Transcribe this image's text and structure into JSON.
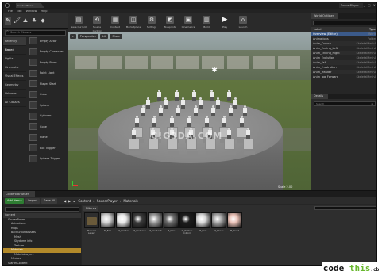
{
  "titlebar": {
    "doc_tab": "ContentExam...",
    "project": "SoccerPlayer",
    "controls": [
      "_",
      "□",
      "✕"
    ]
  },
  "menu": [
    "File",
    "Edit",
    "Window",
    "Help"
  ],
  "modes": {
    "search_placeholder": "Search Classes",
    "categories": [
      "Recently Placed",
      "Basic",
      "Lights",
      "Cinematic",
      "Visual Effects",
      "Geometry",
      "Volumes",
      "All Classes"
    ],
    "items": [
      "Empty Actor",
      "Empty Character",
      "Empty Pawn",
      "Point Light",
      "Player Start",
      "Cube",
      "Sphere",
      "Cylinder",
      "Cone",
      "Plane",
      "Box Trigger",
      "Sphere Trigger"
    ]
  },
  "toolbar": [
    {
      "label": "Save Current",
      "icon": "save-icon",
      "glyph": "▤"
    },
    {
      "label": "Source Control",
      "icon": "source-control-icon",
      "glyph": "⟲"
    },
    {
      "label": "Content",
      "icon": "content-icon",
      "glyph": "▦"
    },
    {
      "label": "Marketplace",
      "icon": "marketplace-icon",
      "glyph": "◫"
    },
    {
      "label": "Settings",
      "icon": "settings-icon",
      "glyph": "⚙"
    },
    {
      "label": "Blueprints",
      "icon": "blueprints-icon",
      "glyph": "◩"
    },
    {
      "label": "Cinematics",
      "icon": "cinematics-icon",
      "glyph": "▣"
    },
    {
      "label": "Build",
      "icon": "build-icon",
      "glyph": "▥"
    },
    {
      "label": "Play",
      "icon": "play-icon",
      "glyph": "▶"
    },
    {
      "label": "Launch",
      "icon": "launch-icon",
      "glyph": "⌂"
    }
  ],
  "viewport": {
    "buttons": [
      "▾",
      "Perspective",
      "Lit",
      "Show"
    ],
    "watermark": "C!G3DA.COM",
    "scale_label": "Scale 2.00"
  },
  "outliner": {
    "tab": "World Outliner",
    "col_label": "Label",
    "col_type": "Type",
    "rows": [
      {
        "label": "Overview (Editor)",
        "type": "World"
      },
      {
        "label": "Animations",
        "type": "Folder"
      },
      {
        "label": "Anim_Crouch",
        "type": "SkeletalMeshA"
      },
      {
        "label": "Anim_Ending_Left",
        "type": "SkeletalMeshA"
      },
      {
        "label": "Anim_Ending_Right",
        "type": "SkeletalMeshA"
      },
      {
        "label": "Anim_Evolution",
        "type": "SkeletalMeshA"
      },
      {
        "label": "Anim_Fall",
        "type": "SkeletalMeshA"
      },
      {
        "label": "Anim_Frustration",
        "type": "SkeletalMeshA"
      },
      {
        "label": "Anim_Header",
        "type": "SkeletalMeshA"
      },
      {
        "label": "Anim_Jog_Forward",
        "type": "SkeletalMeshA"
      }
    ],
    "footer_count": "54 actors",
    "footer_view": "View Options"
  },
  "details": {
    "tab": "Details",
    "placeholder": "Search",
    "toggle": "◉"
  },
  "content_browser": {
    "tab": "Content Browser",
    "add_new": "Add New ▾",
    "import": "Import",
    "save_all": "Save All",
    "breadcrumb": [
      "Content",
      "SoccerPlayer",
      "Materials"
    ],
    "filters": "Filters ▾",
    "tree": [
      {
        "label": "Content",
        "level": 0,
        "kind": "root"
      },
      {
        "label": "SoccerPlayer",
        "level": 1
      },
      {
        "label": "Animations",
        "level": 2
      },
      {
        "label": "Maps",
        "level": 2
      },
      {
        "label": "BackGroundAssets",
        "level": 2
      },
      {
        "label": "Mesh",
        "level": 3
      },
      {
        "label": "Skydome info",
        "level": 3
      },
      {
        "label": "Texture",
        "level": 3
      },
      {
        "label": "Materials",
        "level": 2,
        "kind": "sel"
      },
      {
        "label": "MaterialLayers",
        "level": 3
      },
      {
        "label": "Meshes",
        "level": 2
      },
      {
        "label": "StarterContent",
        "level": 1
      },
      {
        "label": "Textures",
        "level": 2
      },
      {
        "label": "Decal",
        "level": 3
      },
      {
        "label": "Models",
        "level": 3
      },
      {
        "label": "TextureLayers",
        "level": 3
      }
    ],
    "assets": [
      {
        "label": "Material Layers",
        "kind": "folder"
      },
      {
        "label": "M_Ball",
        "color": "#cfcfcf"
      },
      {
        "label": "M_Clothes",
        "color": "#e8e8e8"
      },
      {
        "label": "M_Clothes2",
        "color": "#3a3a3a"
      },
      {
        "label": "M_Clothes3",
        "color": "#9a9a9a"
      },
      {
        "label": "M_Hair",
        "color": "#6a6a6a"
      },
      {
        "label": "M_Pattern Uniform",
        "color": "#1c1c1c"
      },
      {
        "label": "M_Skin",
        "color": "#d8d8d8"
      },
      {
        "label": "M_Shoes",
        "color": "#a6a6a6"
      },
      {
        "label": "M_Skin2",
        "color": "#e9c0b5"
      }
    ]
  },
  "brand": {
    "text_a": "code",
    "text_b": "this",
    "suffix": ".cb"
  }
}
